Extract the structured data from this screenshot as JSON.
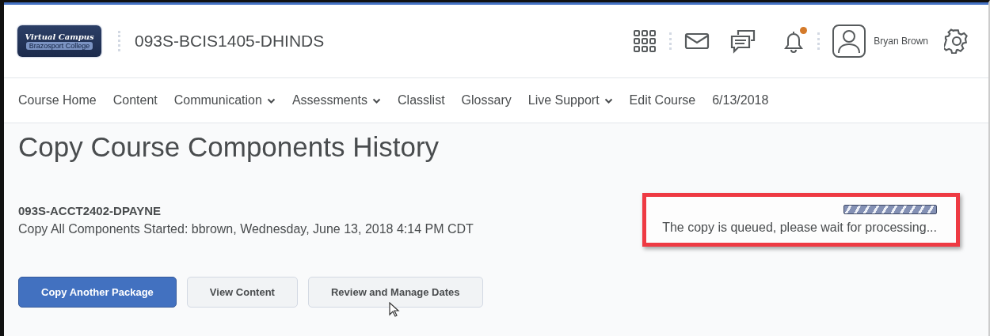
{
  "header": {
    "logo": {
      "title": "Virtual Campus",
      "subtitle": "Brazosport College"
    },
    "course_title": "093S-BCIS1405-DHINDS",
    "notifications_unread": true,
    "user_name": "Bryan Brown"
  },
  "nav": [
    {
      "label": "Course Home",
      "dropdown": false
    },
    {
      "label": "Content",
      "dropdown": false
    },
    {
      "label": "Communication",
      "dropdown": true
    },
    {
      "label": "Assessments",
      "dropdown": true
    },
    {
      "label": "Classlist",
      "dropdown": false
    },
    {
      "label": "Glossary",
      "dropdown": false
    },
    {
      "label": "Live Support",
      "dropdown": true
    },
    {
      "label": "Edit Course",
      "dropdown": false
    },
    {
      "label": "6/13/2018",
      "dropdown": false
    }
  ],
  "page_title": "Copy Course Components History",
  "entry": {
    "source": "093S-ACCT2402-DPAYNE",
    "detail": "Copy All Components Started: bbrown, Wednesday, June 13, 2018 4:14 PM CDT",
    "status": "The copy is queued, please wait for processing...",
    "highlighted": true
  },
  "buttons": [
    {
      "label": "Copy Another Package",
      "primary": true
    },
    {
      "label": "View Content",
      "primary": false
    },
    {
      "label": "Review and Manage Dates",
      "primary": false
    }
  ]
}
